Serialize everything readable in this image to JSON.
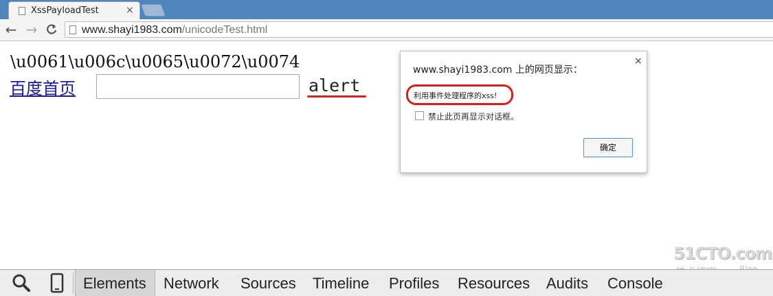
{
  "browser": {
    "tab_title": "XssPayloadTest",
    "tab_close": "×",
    "url_host": "www.shayi1983.com",
    "url_path": "/unicodeTest.html",
    "nav_back": "←",
    "nav_forward": "→",
    "nav_reload": "C"
  },
  "page": {
    "escaped_text": "\\u0061\\u006c\\u0065\\u0072\\u0074",
    "link_text": "百度首页",
    "input_value": "",
    "alert_text": "alert"
  },
  "dialog": {
    "title": "www.shayi1983.com 上的网页显示：",
    "close": "×",
    "message": "利用事件处理程序的xss!",
    "checkbox_label": "禁止此页再显示对话框。",
    "checkbox_checked": false,
    "ok_label": "确定"
  },
  "devtools": {
    "tabs": [
      "Elements",
      "Network",
      "Sources",
      "Timeline",
      "Profiles",
      "Resources",
      "Audits",
      "Console"
    ],
    "active_tab": "Elements",
    "search_icon": "search-icon",
    "device_icon": "device-mode-icon"
  },
  "watermark": {
    "site": "51CTO.com",
    "subtitle": "技术博客",
    "blog": "Blog"
  },
  "colors": {
    "tabstrip": "#4f86bd",
    "annotation_red": "#d32020",
    "link": "#1a1aa6"
  }
}
